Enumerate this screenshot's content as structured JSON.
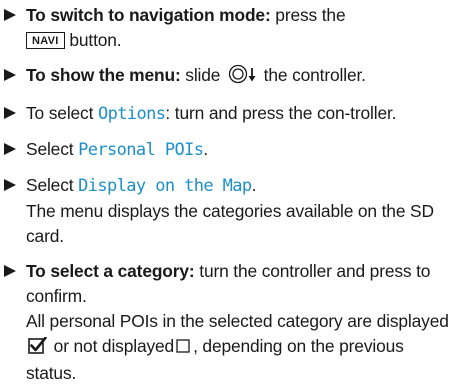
{
  "steps": [
    {
      "bold": "To switch to navigation mode:",
      "text1": " press the",
      "key": "NAVI",
      "text2": " button."
    },
    {
      "bold": "To show the menu:",
      "text1": " slide ",
      "text2": " the controller."
    },
    {
      "text1": "To select ",
      "menu": "Options",
      "text2": ": turn and press the con-troller."
    },
    {
      "text1": "Select ",
      "menu": "Personal POIs",
      "text2": "."
    },
    {
      "text1": "Select ",
      "menu": "Display on the Map",
      "text2": ".",
      "result": "The menu displays the categories available on the SD card."
    },
    {
      "bold": "To select a category:",
      "text1": " turn the controller and press to confirm.",
      "result1": "All personal POIs in the selected category are displayed",
      "result2": " or not displayed",
      "result3": ", depending on the previous status."
    }
  ],
  "colors": {
    "menu_text": "#1d8fc8",
    "body_text": "#1a1a1a"
  },
  "icons": [
    "bullet-arrow-icon",
    "controller-slide-down-icon",
    "checked-checkbox-icon",
    "empty-checkbox-icon"
  ]
}
